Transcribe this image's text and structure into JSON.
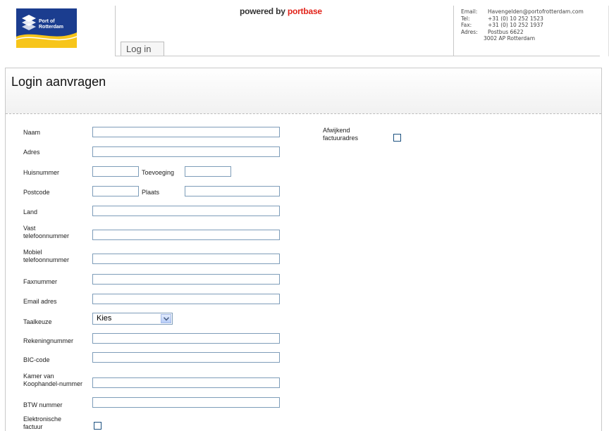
{
  "header": {
    "logo_text": [
      "Port of",
      "Rotterdam"
    ],
    "powered_prefix": "powered by ",
    "powered_brand": "portbase",
    "login_tab": "Log in",
    "contact": {
      "email_label": "Email:",
      "email": "Havengelden@portofrotterdam.com",
      "tel_label": "Tel:",
      "tel": "+31 (0) 10 252 1523",
      "fax_label": "Fax:",
      "fax": "+31 (0) 10 252 1937",
      "address_label": "Adres:",
      "address_line1": "Postbus 6622",
      "address_line2": "3002 AP  Rotterdam"
    }
  },
  "page": {
    "title": "Login aanvragen"
  },
  "form": {
    "naam": "Naam",
    "adres": "Adres",
    "huisnummer": "Huisnummer",
    "toevoeging": "Toevoeging",
    "postcode": "Postcode",
    "plaats": "Plaats",
    "land": "Land",
    "vast_tel": [
      "Vast",
      "telefoonnummer"
    ],
    "mobiel_tel": [
      "Mobiel",
      "telefoonnummer"
    ],
    "faxnummer": "Faxnummer",
    "email": "Email adres",
    "taalkeuze": "Taalkeuze",
    "taalkeuze_value": "Kies",
    "rekeningnummer": "Rekeningnummer",
    "bic": "BIC-code",
    "kvk": [
      "Kamer van",
      "Koophandel-nummer"
    ],
    "btw": "BTW nummer",
    "elektronische_factuur": [
      "Elektronische",
      "factuur"
    ],
    "afwijkend_factuuradres": [
      "Afwijkend",
      "factuuradres"
    ]
  },
  "colors": {
    "portbase_red": "#e2231a",
    "port_blue": "#1b3d8f",
    "port_yellow": "#f7c51a"
  }
}
